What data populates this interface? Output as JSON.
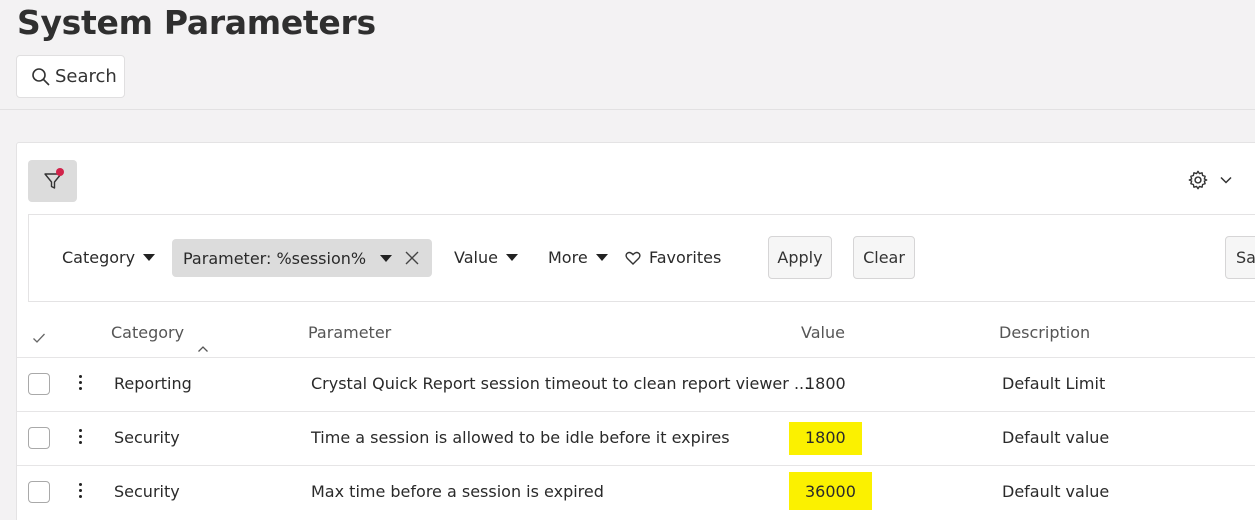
{
  "page": {
    "title": "System Parameters"
  },
  "search": {
    "label": "Search"
  },
  "filter_bar": {
    "category_label": "Category",
    "parameter_chip": "Parameter: %session%",
    "value_label": "Value",
    "more_label": "More",
    "favorites_label": "Favorites",
    "apply_label": "Apply",
    "clear_label": "Clear",
    "save_label_partial": "Sav"
  },
  "table": {
    "headers": {
      "category": "Category",
      "parameter": "Parameter",
      "value": "Value",
      "description": "Description"
    },
    "rows": [
      {
        "category": "Reporting",
        "parameter": "Crystal Quick Report session timeout to clean report viewer ...",
        "value": "1800",
        "description": "Default Limit",
        "highlighted": false
      },
      {
        "category": "Security",
        "parameter": "Time a session is allowed to be idle before it expires",
        "value": "1800",
        "description": "Default value",
        "highlighted": true
      },
      {
        "category": "Security",
        "parameter": "Max time before a session is expired",
        "value": "36000",
        "description": "Default value",
        "highlighted": true
      }
    ]
  },
  "colors": {
    "highlight": "#fbf100",
    "filter_dot": "#d1234a",
    "chip_bg": "#dcdcdc"
  },
  "icons": [
    "search-icon",
    "filter-icon",
    "gear-icon",
    "chevron-down-icon",
    "close-icon",
    "heart-icon",
    "checkmark-icon",
    "sort-up-icon",
    "kebab-icon"
  ]
}
